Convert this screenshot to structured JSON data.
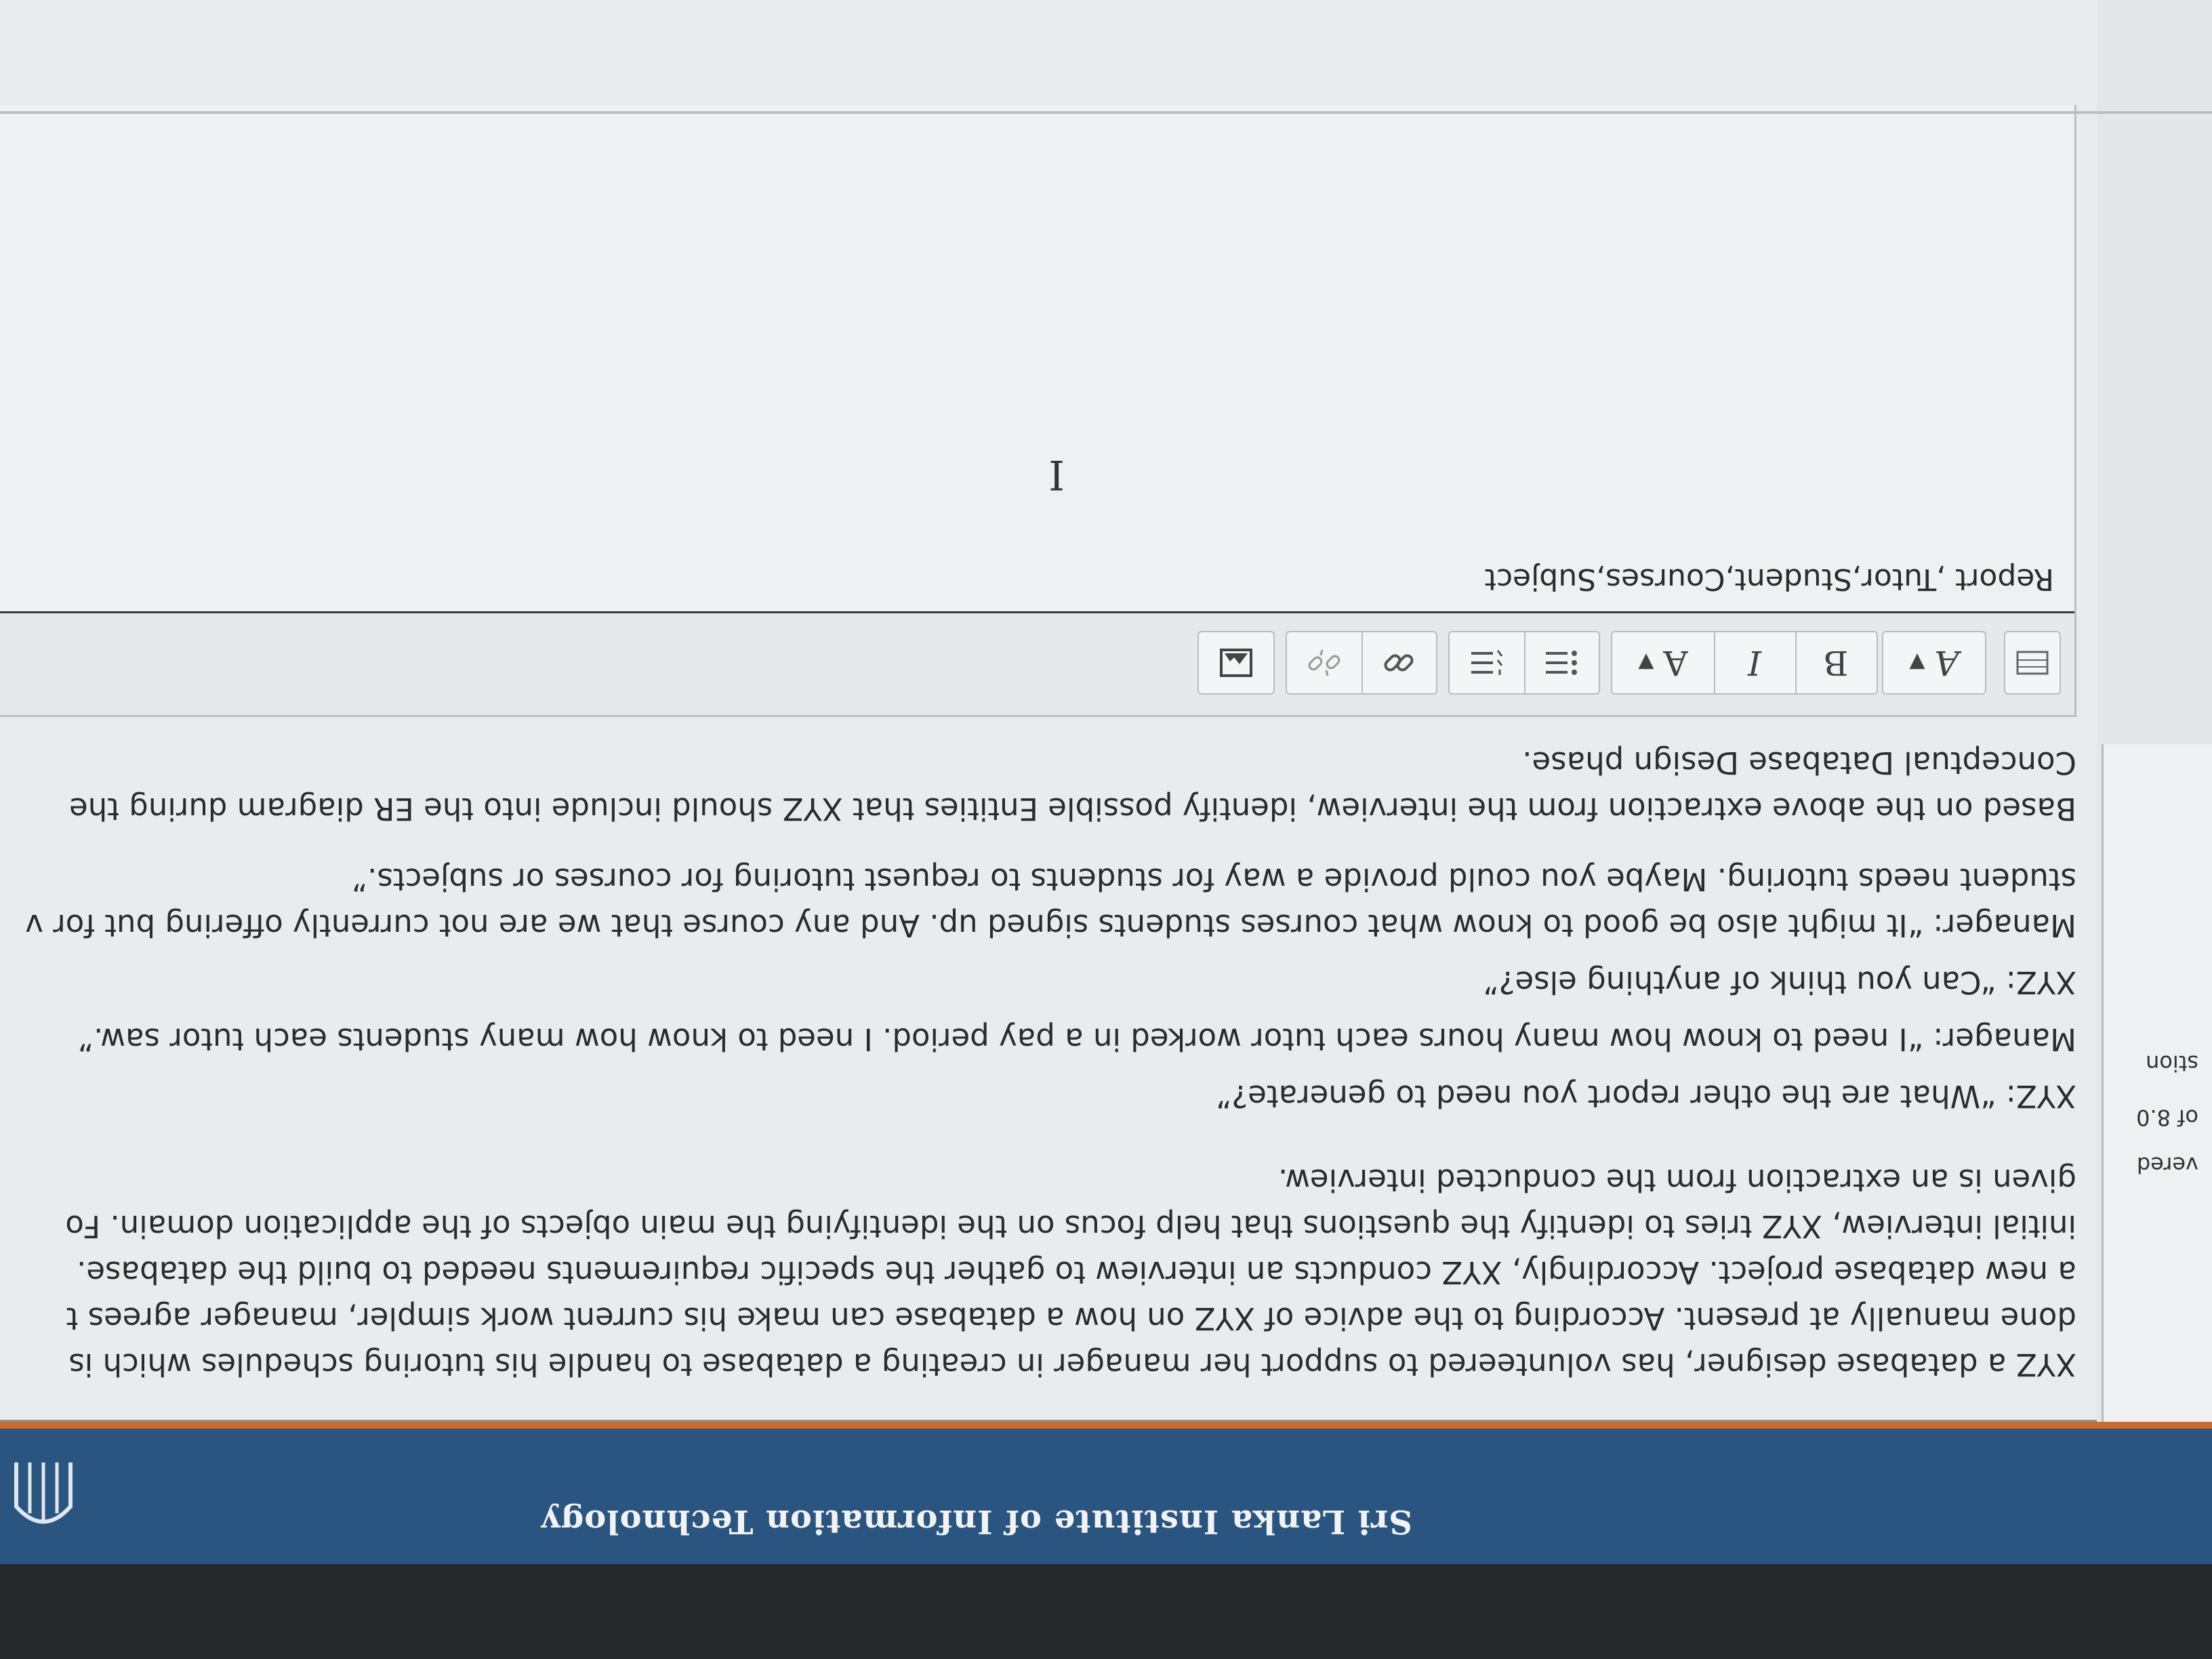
{
  "header": {
    "title": "Sri Lanka Institute of Information Technology"
  },
  "sidebar": {
    "labels": [
      "vered",
      "of 8.0",
      "stion"
    ]
  },
  "question": {
    "paragraphs": [
      "XYZ a database designer, has volunteered to support her manager in creating a database to handle his tutoring schedules which is",
      "done manually at present. According to the advice of XYZ on how a database can make his current work simpler, manager agrees t",
      "a new database project. Accordingly, XYZ conducts an interview to gather the specific requirements needed to build the database.",
      "initial interview, XYZ tries to identify the questions that help focus on the identifying the main objects of the application domain. Fo",
      "given is an extraction from the conducted interview.",
      "XYZ: “What are the other report you need to generate?”",
      "Manager: “I need to know how many hours each tutor worked in a pay period. I need to know how many students each tutor saw.”",
      "XYZ: “Can you think of anything else?”",
      "Manager: “It might also be good to know what courses students signed up. And any course that we are not currently offering but for v",
      "student needs tutoring. Maybe you could provide a way for students to request tutoring for courses or subjects.”",
      "Based on the above extraction from the interview, identify possible Entities that XYZ should include into the ER diagram during the",
      "Conceptual Database Design phase."
    ]
  },
  "editor": {
    "toolbar": {
      "paragraph_format": "A",
      "bold": "B",
      "italic": "I",
      "font_color": "A"
    },
    "content": "Report ,Tutor,Student,Courses,Subject",
    "cursor": "I"
  },
  "colors": {
    "header_bg": "#2a5580",
    "header_accent": "#d06a2a",
    "panel_bg": "#e9ecee"
  }
}
